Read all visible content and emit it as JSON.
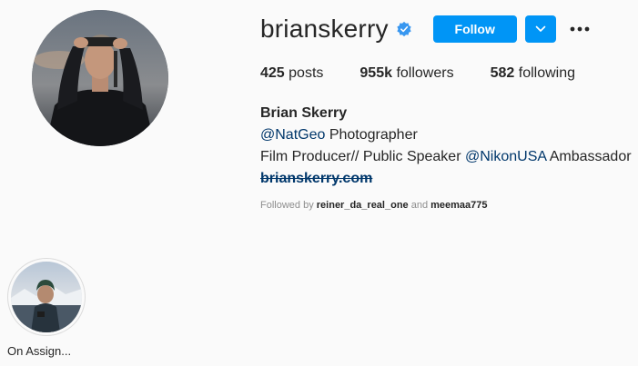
{
  "profile": {
    "username": "brianskerry",
    "follow_label": "Follow",
    "verified": true,
    "accent": "#0095f6"
  },
  "stats": {
    "posts": "425",
    "posts_label": "posts",
    "followers": "955k",
    "followers_label": "followers",
    "following": "582",
    "following_label": "following"
  },
  "bio": {
    "name": "Brian Skerry",
    "line1_mention": "@NatGeo",
    "line1_rest": " Photographer",
    "line2_start": "Film Producer// Public Speaker ",
    "line2_mention": "@NikonUSA",
    "line2_rest": " Ambassador",
    "website": "brianskerry.com"
  },
  "followed_by": {
    "prefix": "Followed by ",
    "user1": "reiner_da_real_one",
    "joiner": " and ",
    "user2": "meemaa775"
  },
  "highlights": [
    {
      "label": "On Assign..."
    }
  ]
}
